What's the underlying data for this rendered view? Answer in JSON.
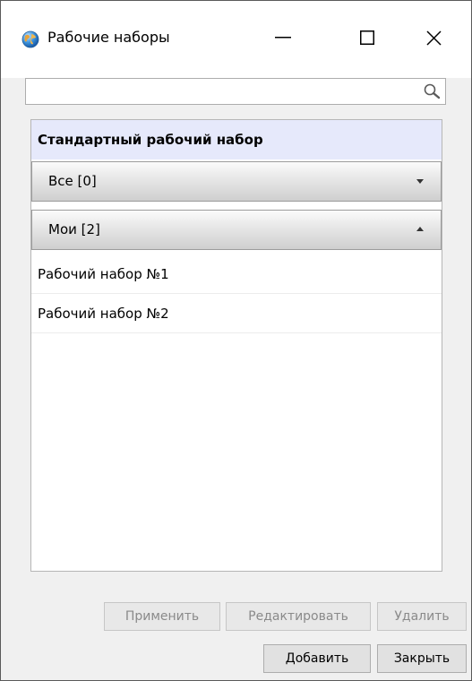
{
  "window": {
    "title": "Рабочие наборы",
    "icon": "globe-icon"
  },
  "search": {
    "value": "",
    "placeholder": "",
    "icon": "search-icon"
  },
  "panel": {
    "standard_label": "Стандартный рабочий набор",
    "groups": [
      {
        "label": "Все [0]",
        "state": "collapsed"
      },
      {
        "label": "Мои [2]",
        "state": "expanded"
      }
    ],
    "items": [
      {
        "label": "Рабочий набор №1"
      },
      {
        "label": "Рабочий набор №2"
      }
    ]
  },
  "buttons": {
    "apply": "Применить",
    "edit": "Редактировать",
    "delete": "Удалить",
    "add": "Добавить",
    "close": "Закрыть"
  }
}
